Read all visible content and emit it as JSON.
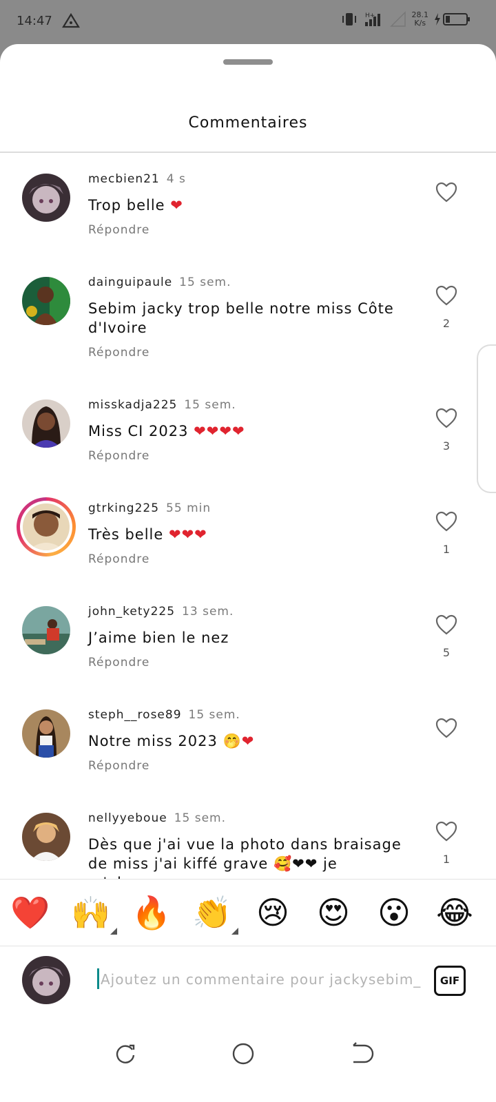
{
  "status_bar": {
    "time": "14:47",
    "speed_value": "28.1",
    "speed_unit": "K/s",
    "network": "H+"
  },
  "sheet": {
    "title": "Commentaires",
    "reply_label": "Répondre"
  },
  "comments": [
    {
      "user": "mecbien21",
      "time": "4 s",
      "text": "Trop belle ",
      "hearts": 1,
      "likes": ""
    },
    {
      "user": "dainguipaule",
      "time": "15 sem.",
      "text": "Sebim jacky trop belle notre miss Côte d'Ivoire",
      "hearts": 0,
      "likes": "2"
    },
    {
      "user": "misskadja225",
      "time": "15 sem.",
      "text": "Miss CI 2023 ",
      "hearts": 4,
      "likes": "3"
    },
    {
      "user": "gtrking225",
      "time": "55 min",
      "text": "Très belle ",
      "hearts": 3,
      "likes": "1"
    },
    {
      "user": "john_kety225",
      "time": "13 sem.",
      "text": "J’aime bien le nez",
      "hearts": 0,
      "likes": "5"
    },
    {
      "user": "steph__rose89",
      "time": "15 sem.",
      "text": "Notre miss 2023  🤭",
      "hearts": 1,
      "likes": ""
    },
    {
      "user": "nellyyeboue",
      "time": "15 sem.",
      "text": "Dès que j'ai vue la photo dans braisage de miss j'ai kiffé grave 🥰❤❤ je m'abonne a",
      "hearts": 0,
      "likes": "1"
    }
  ],
  "emoji_bar": [
    "❤️",
    "🙌",
    "🔥",
    "👏",
    "😢",
    "😍",
    "😮",
    "😂"
  ],
  "composer": {
    "placeholder": "Ajoutez un commentaire pour jackysebim_",
    "gif_label": "GIF"
  },
  "colors": {
    "heart_red": "#e0242f",
    "story_ring": "#e1306c"
  }
}
